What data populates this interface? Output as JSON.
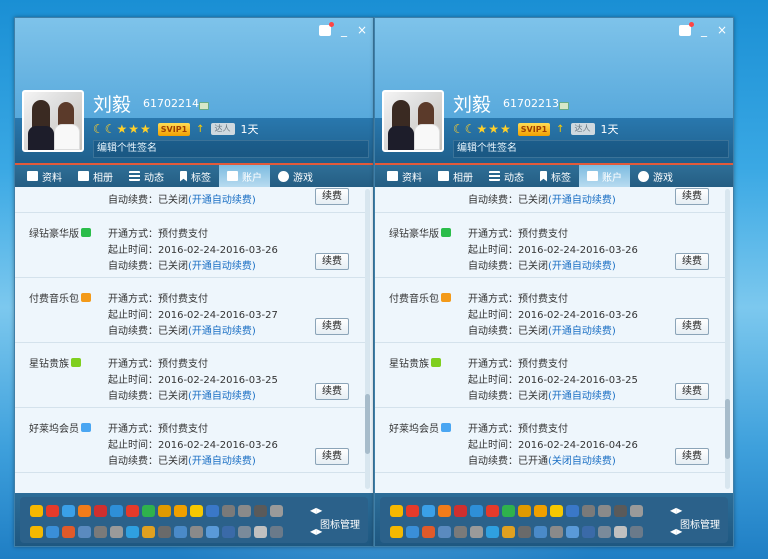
{
  "windows": [
    {
      "id": "left",
      "user": {
        "name": "刘毅",
        "qq": "61702214",
        "svip": "SVIP1",
        "daren": "达人",
        "days": "1天"
      },
      "signature_placeholder": "编辑个性签名",
      "tabs": [
        "资料",
        "相册",
        "动态",
        "标签",
        "账户",
        "游戏"
      ],
      "active_tab": "账户",
      "first_row": {
        "label": "自动续费：",
        "value": "已关闭",
        "link": "(开通自动续费)",
        "button": "续费"
      },
      "services": [
        {
          "name": "绿钻豪华版",
          "icon_color": "#2bbd4a",
          "method_label": "开通方式：",
          "method": "预付费支付",
          "period_label": "起止时间：",
          "period": "2016-02-24-2016-03-26",
          "auto_label": "自动续费：",
          "auto": "已关闭",
          "auto_link": "(开通自动续费)",
          "button": "续费"
        },
        {
          "name": "付费音乐包",
          "icon_color": "#f39a1a",
          "method_label": "开通方式：",
          "method": "预付费支付",
          "period_label": "起止时间：",
          "period": "2016-02-24-2016-03-27",
          "auto_label": "自动续费：",
          "auto": "已关闭",
          "auto_link": "(开通自动续费)",
          "button": "续费"
        },
        {
          "name": "星钻贵族",
          "icon_color": "#7fcf1f",
          "method_label": "开通方式：",
          "method": "预付费支付",
          "period_label": "起止时间：",
          "period": "2016-02-24-2016-03-25",
          "auto_label": "自动续费：",
          "auto": "已关闭",
          "auto_link": "(开通自动续费)",
          "button": "续费"
        },
        {
          "name": "好莱坞会员",
          "icon_color": "#4aa6f2",
          "method_label": "开通方式：",
          "method": "预付费支付",
          "period_label": "起止时间：",
          "period": "2016-02-24-2016-03-26",
          "auto_label": "自动续费：",
          "auto": "已关闭",
          "auto_link": "(开通自动续费)",
          "button": "续费"
        }
      ],
      "footer_label": "图标管理"
    },
    {
      "id": "right",
      "user": {
        "name": "刘毅",
        "qq": "61702213",
        "svip": "SVIP1",
        "daren": "达人",
        "days": "1天"
      },
      "signature_placeholder": "编辑个性签名",
      "tabs": [
        "资料",
        "相册",
        "动态",
        "标签",
        "账户",
        "游戏"
      ],
      "active_tab": "账户",
      "first_row": {
        "label": "自动续费：",
        "value": "已关闭",
        "link": "(开通自动续费)",
        "button": "续费"
      },
      "services": [
        {
          "name": "绿钻豪华版",
          "icon_color": "#2bbd4a",
          "method_label": "开通方式：",
          "method": "预付费支付",
          "period_label": "起止时间：",
          "period": "2016-02-24-2016-03-26",
          "auto_label": "自动续费：",
          "auto": "已关闭",
          "auto_link": "(开通自动续费)",
          "button": "续费"
        },
        {
          "name": "付费音乐包",
          "icon_color": "#f39a1a",
          "method_label": "开通方式：",
          "method": "预付费支付",
          "period_label": "起止时间：",
          "period": "2016-02-24-2016-03-26",
          "auto_label": "自动续费：",
          "auto": "已关闭",
          "auto_link": "(开通自动续费)",
          "button": "续费"
        },
        {
          "name": "星钻贵族",
          "icon_color": "#7fcf1f",
          "method_label": "开通方式：",
          "method": "预付费支付",
          "period_label": "起止时间：",
          "period": "2016-02-24-2016-03-25",
          "auto_label": "自动续费：",
          "auto": "已关闭",
          "auto_link": "(开通自动续费)",
          "button": "续费"
        },
        {
          "name": "好莱坞会员",
          "icon_color": "#4aa6f2",
          "method_label": "开通方式：",
          "method": "预付费支付",
          "period_label": "起止时间：",
          "period": "2016-02-24-2016-04-26",
          "auto_label": "自动续费：",
          "auto": "已开通",
          "auto_link": "(关闭自动续费)",
          "button": "续费"
        }
      ],
      "footer_label": "图标管理"
    }
  ],
  "window_controls": {
    "minimize": "_",
    "close": "×"
  },
  "footer_icon_colors": [
    "#f5b800",
    "#e53a2a",
    "#3aa0e8",
    "#f07c1a",
    "#cf2f2f",
    "#2e8fd8",
    "#e53a2a",
    "#2fb24c",
    "#e09a00",
    "#f0a000",
    "#f5c800",
    "#3a78c8",
    "#7a7a7a",
    "#8a8a8a",
    "#5a5a5a",
    "#9a9a9a"
  ],
  "footer_icon_colors_row2": [
    "#f5b800",
    "#3a8fd8",
    "#e05a2a",
    "#5a8abf",
    "#7a7a7a",
    "#9a9a9a",
    "#2fa0e0",
    "#e0a020",
    "#6a6a6a",
    "#4a8ac8",
    "#8a8a8a",
    "#5a9ad8",
    "#3a6aa8",
    "#7a8a9a",
    "#c0c0c0",
    "#6a7a8a"
  ]
}
